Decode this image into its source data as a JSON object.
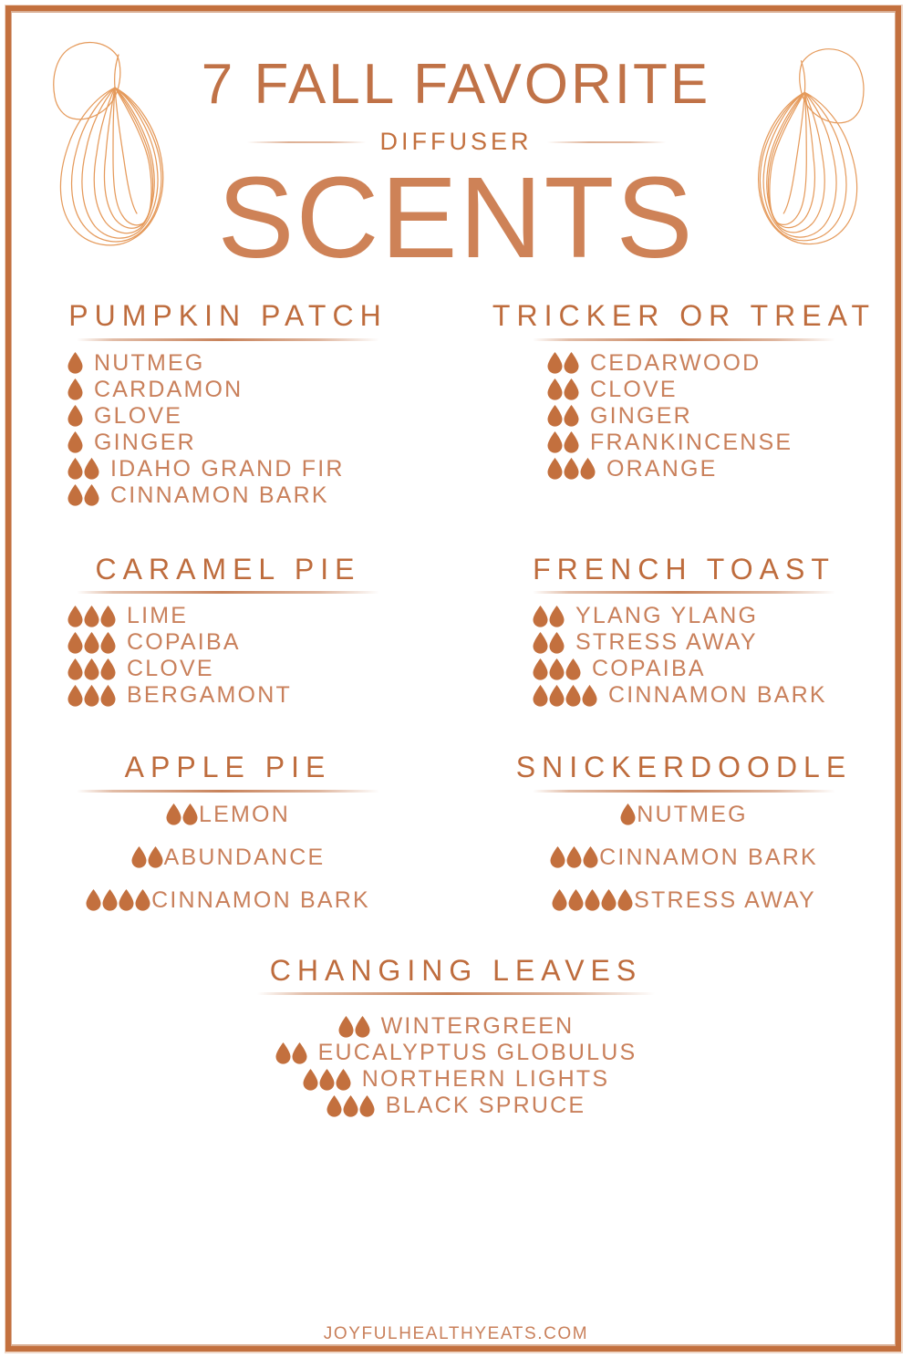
{
  "header": {
    "line1": "7 FALL FAVORITE",
    "line2": "DIFFUSER",
    "line3": "SCENTS"
  },
  "colors": {
    "frame": "#C3703E",
    "heading": "#BE6C3D",
    "title": "#C07247",
    "scents": "#CE8257",
    "item_text": "#C9805B",
    "drop": "#C3703E",
    "pear_outline": "#E59A5B"
  },
  "icons": {
    "drop": "water-drop-icon",
    "pear_left": "pear-outline-icon",
    "pear_right": "pear-outline-icon"
  },
  "sections": [
    {
      "id": "pumpkin-patch",
      "title": "PUMPKIN PATCH",
      "items": [
        {
          "name": "NUTMEG",
          "drops": 1
        },
        {
          "name": "CARDAMON",
          "drops": 1
        },
        {
          "name": "GLOVE",
          "drops": 1
        },
        {
          "name": "GINGER",
          "drops": 1
        },
        {
          "name": "IDAHO GRAND FIR",
          "drops": 2
        },
        {
          "name": "CINNAMON BARK",
          "drops": 2
        }
      ]
    },
    {
      "id": "tricker-or-treat",
      "title": "TRICKER OR TREAT",
      "items": [
        {
          "name": "CEDARWOOD",
          "drops": 2
        },
        {
          "name": "CLOVE",
          "drops": 2
        },
        {
          "name": "GINGER",
          "drops": 2
        },
        {
          "name": "FRANKINCENSE",
          "drops": 2
        },
        {
          "name": "ORANGE",
          "drops": 3
        }
      ]
    },
    {
      "id": "caramel-pie",
      "title": "CARAMEL PIE",
      "items": [
        {
          "name": "LIME",
          "drops": 3
        },
        {
          "name": "COPAIBA",
          "drops": 3
        },
        {
          "name": "CLOVE",
          "drops": 3
        },
        {
          "name": "BERGAMONT",
          "drops": 3
        }
      ]
    },
    {
      "id": "french-toast",
      "title": "FRENCH TOAST",
      "items": [
        {
          "name": "YLANG YLANG",
          "drops": 2
        },
        {
          "name": "STRESS AWAY",
          "drops": 2
        },
        {
          "name": "COPAIBA",
          "drops": 3
        },
        {
          "name": "CINNAMON BARK",
          "drops": 4
        }
      ]
    },
    {
      "id": "apple-pie",
      "title": "APPLE PIE",
      "items": [
        {
          "name": "LEMON",
          "drops": 2
        },
        {
          "name": "ABUNDANCE",
          "drops": 2
        },
        {
          "name": "CINNAMON BARK",
          "drops": 4
        }
      ]
    },
    {
      "id": "snickerdoodle",
      "title": "SNICKERDOODLE",
      "items": [
        {
          "name": "NUTMEG",
          "drops": 1
        },
        {
          "name": "CINNAMON BARK",
          "drops": 3
        },
        {
          "name": "STRESS AWAY",
          "drops": 5
        }
      ]
    },
    {
      "id": "changing-leaves",
      "title": "CHANGING LEAVES",
      "items": [
        {
          "name": "WINTERGREEN",
          "drops": 2
        },
        {
          "name": "EUCALYPTUS GLOBULUS",
          "drops": 2
        },
        {
          "name": "NORTHERN LIGHTS",
          "drops": 3
        },
        {
          "name": "BLACK SPRUCE",
          "drops": 3
        }
      ]
    }
  ],
  "footer": {
    "site": "JOYFULHEALTHYEATS.COM"
  }
}
